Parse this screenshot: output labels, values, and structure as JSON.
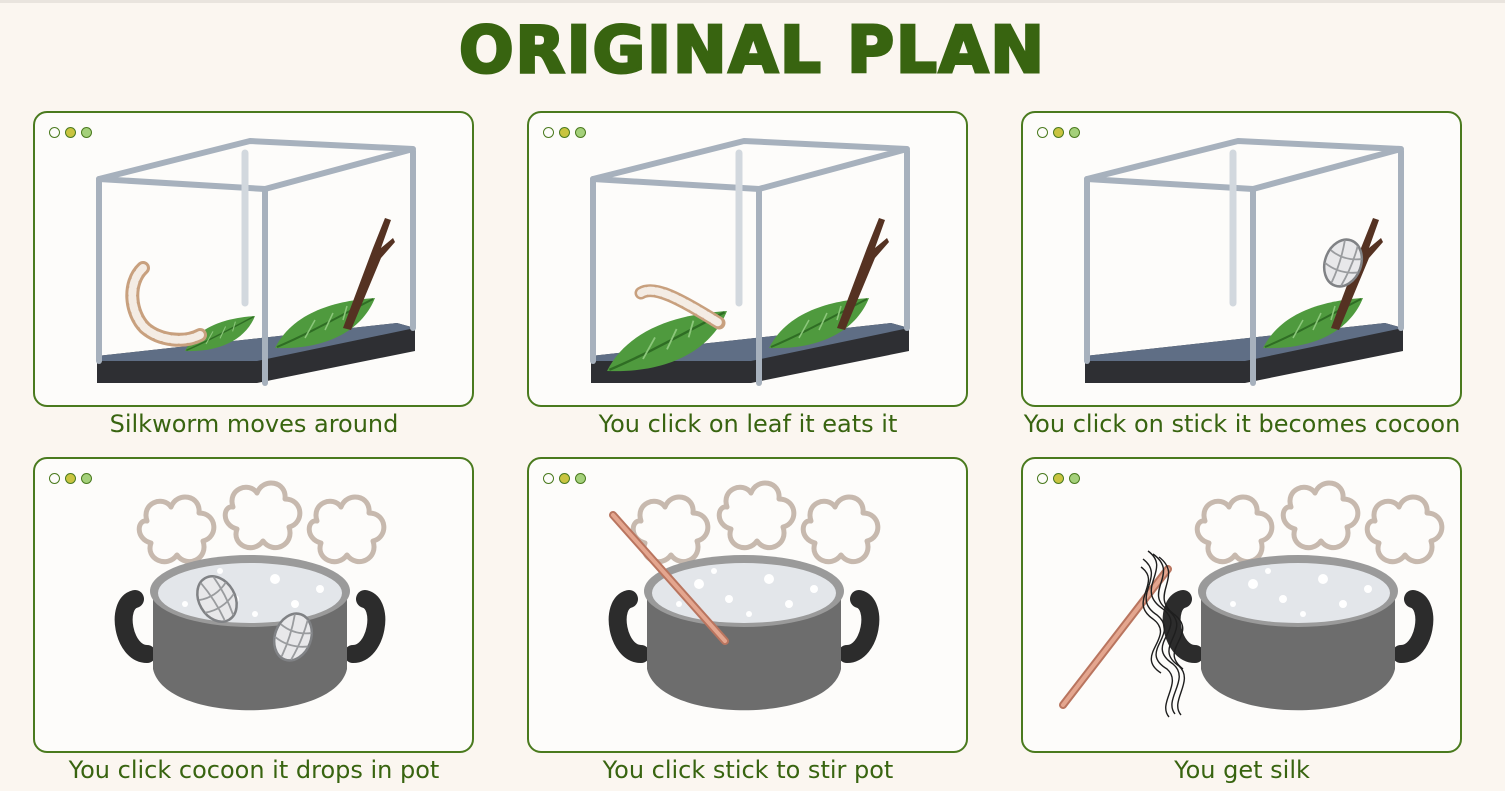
{
  "title": "ORIGINAL PLAN",
  "steps": [
    {
      "caption": "Silkworm moves around"
    },
    {
      "caption": "You click on leaf it eats it"
    },
    {
      "caption": "You click on stick it becomes cocoon"
    },
    {
      "caption": "You click cocoon it drops in pot"
    },
    {
      "caption": "You click stick to stir pot"
    },
    {
      "caption": "You get silk"
    }
  ],
  "colors": {
    "title": "#386410",
    "panel_border": "#4a7a1e",
    "background": "#fbf6f0"
  }
}
